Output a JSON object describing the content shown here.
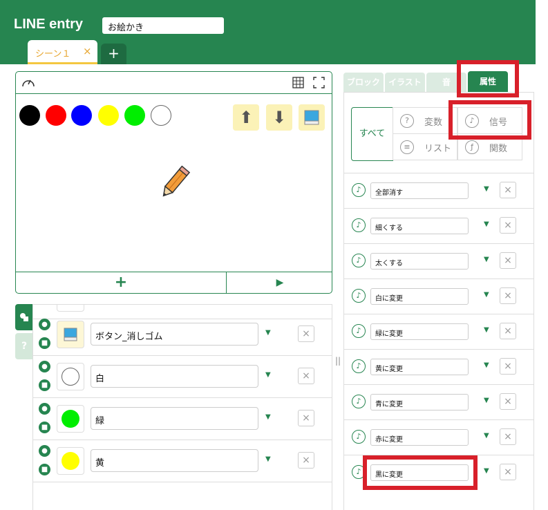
{
  "app": {
    "logo": "LINE entry",
    "project_name": "お絵かき"
  },
  "scene": {
    "tab_label": "シーン１",
    "close": "×",
    "add": "+"
  },
  "stage": {
    "colors": [
      "#000000",
      "#ff0000",
      "#0000ff",
      "#ffff00",
      "#00e000",
      "#ffffff"
    ],
    "up_icon": "⬆",
    "down_icon": "⬇",
    "add": "+",
    "play": "▶"
  },
  "side_tabs": {
    "help": "?"
  },
  "objects": [
    {
      "name": "ボタン_消しゴム",
      "color": null
    },
    {
      "name": "白",
      "color": "#ffffff"
    },
    {
      "name": "緑",
      "color": "#00e000"
    },
    {
      "name": "黄",
      "color": "#ffff00"
    }
  ],
  "right": {
    "tabs": [
      "ブロック",
      "イラスト",
      "音",
      "属性"
    ],
    "all": "すべて",
    "categories": [
      {
        "icon": "?",
        "label": "変数"
      },
      {
        "icon": "♪",
        "label": "信号"
      },
      {
        "icon": "≡",
        "label": "リスト"
      },
      {
        "icon": "ƒ",
        "label": "関数"
      }
    ],
    "signals": [
      "全部消す",
      "細くする",
      "太くする",
      "白に変更",
      "緑に変更",
      "黄に変更",
      "青に変更",
      "赤に変更",
      "黒に変更"
    ],
    "delete": "×"
  }
}
